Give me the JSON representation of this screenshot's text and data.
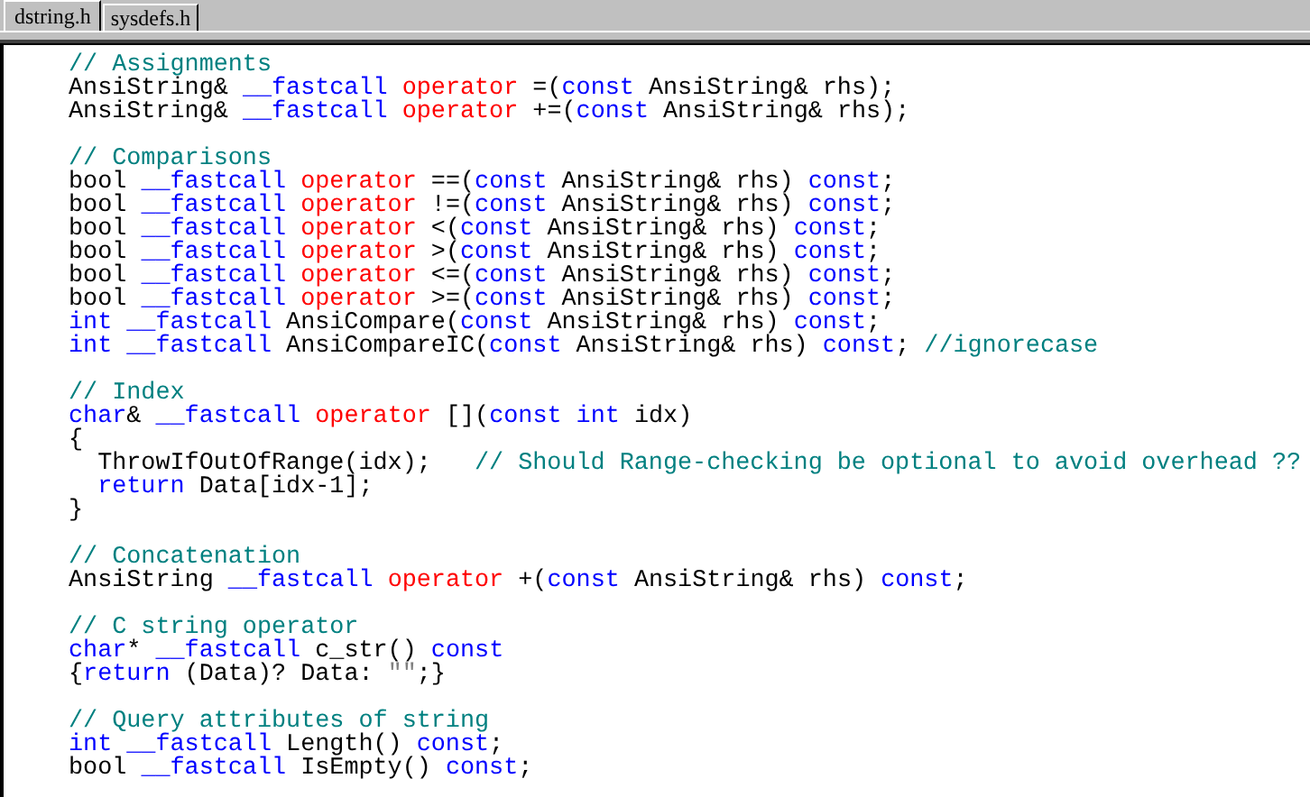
{
  "tabs": [
    {
      "label": "dstring.h",
      "selected": true
    },
    {
      "label": "sysdefs.h",
      "selected": false
    }
  ],
  "blocks": [
    {
      "lines": [
        {
          "tokens": [
            {
              "kind": "comment",
              "text": "// Assignments"
            }
          ]
        },
        {
          "tokens": [
            {
              "kind": "plain",
              "text": "AnsiString& "
            },
            {
              "kind": "keyword",
              "text": "__fastcall "
            },
            {
              "kind": "operator",
              "text": "operator"
            },
            {
              "kind": "plain",
              "text": " =("
            },
            {
              "kind": "keyword",
              "text": "const"
            },
            {
              "kind": "plain",
              "text": " AnsiString& rhs);"
            }
          ]
        },
        {
          "tokens": [
            {
              "kind": "plain",
              "text": "AnsiString& "
            },
            {
              "kind": "keyword",
              "text": "__fastcall "
            },
            {
              "kind": "operator",
              "text": "operator"
            },
            {
              "kind": "plain",
              "text": " +=("
            },
            {
              "kind": "keyword",
              "text": "const"
            },
            {
              "kind": "plain",
              "text": " AnsiString& rhs);"
            }
          ]
        }
      ]
    },
    {
      "lines": [
        {
          "tokens": [
            {
              "kind": "comment",
              "text": "// Comparisons"
            }
          ]
        },
        {
          "tokens": [
            {
              "kind": "plain",
              "text": "bool "
            },
            {
              "kind": "keyword",
              "text": "__fastcall "
            },
            {
              "kind": "operator",
              "text": "operator"
            },
            {
              "kind": "plain",
              "text": " ==("
            },
            {
              "kind": "keyword",
              "text": "const"
            },
            {
              "kind": "plain",
              "text": " AnsiString& rhs) "
            },
            {
              "kind": "keyword",
              "text": "const"
            },
            {
              "kind": "plain",
              "text": ";"
            }
          ]
        },
        {
          "tokens": [
            {
              "kind": "plain",
              "text": "bool "
            },
            {
              "kind": "keyword",
              "text": "__fastcall "
            },
            {
              "kind": "operator",
              "text": "operator"
            },
            {
              "kind": "plain",
              "text": " !=("
            },
            {
              "kind": "keyword",
              "text": "const"
            },
            {
              "kind": "plain",
              "text": " AnsiString& rhs) "
            },
            {
              "kind": "keyword",
              "text": "const"
            },
            {
              "kind": "plain",
              "text": ";"
            }
          ]
        },
        {
          "tokens": [
            {
              "kind": "plain",
              "text": "bool "
            },
            {
              "kind": "keyword",
              "text": "__fastcall "
            },
            {
              "kind": "operator",
              "text": "operator"
            },
            {
              "kind": "plain",
              "text": " <("
            },
            {
              "kind": "keyword",
              "text": "const"
            },
            {
              "kind": "plain",
              "text": " AnsiString& rhs) "
            },
            {
              "kind": "keyword",
              "text": "const"
            },
            {
              "kind": "plain",
              "text": ";"
            }
          ]
        },
        {
          "tokens": [
            {
              "kind": "plain",
              "text": "bool "
            },
            {
              "kind": "keyword",
              "text": "__fastcall "
            },
            {
              "kind": "operator",
              "text": "operator"
            },
            {
              "kind": "plain",
              "text": " >("
            },
            {
              "kind": "keyword",
              "text": "const"
            },
            {
              "kind": "plain",
              "text": " AnsiString& rhs) "
            },
            {
              "kind": "keyword",
              "text": "const"
            },
            {
              "kind": "plain",
              "text": ";"
            }
          ]
        },
        {
          "tokens": [
            {
              "kind": "plain",
              "text": "bool "
            },
            {
              "kind": "keyword",
              "text": "__fastcall "
            },
            {
              "kind": "operator",
              "text": "operator"
            },
            {
              "kind": "plain",
              "text": " <=("
            },
            {
              "kind": "keyword",
              "text": "const"
            },
            {
              "kind": "plain",
              "text": " AnsiString& rhs) "
            },
            {
              "kind": "keyword",
              "text": "const"
            },
            {
              "kind": "plain",
              "text": ";"
            }
          ]
        },
        {
          "tokens": [
            {
              "kind": "plain",
              "text": "bool "
            },
            {
              "kind": "keyword",
              "text": "__fastcall "
            },
            {
              "kind": "operator",
              "text": "operator"
            },
            {
              "kind": "plain",
              "text": " >=("
            },
            {
              "kind": "keyword",
              "text": "const"
            },
            {
              "kind": "plain",
              "text": " AnsiString& rhs) "
            },
            {
              "kind": "keyword",
              "text": "const"
            },
            {
              "kind": "plain",
              "text": ";"
            }
          ]
        },
        {
          "tokens": [
            {
              "kind": "keyword",
              "text": "int __fastcall"
            },
            {
              "kind": "plain",
              "text": " AnsiCompare("
            },
            {
              "kind": "keyword",
              "text": "const"
            },
            {
              "kind": "plain",
              "text": " AnsiString& rhs) "
            },
            {
              "kind": "keyword",
              "text": "const"
            },
            {
              "kind": "plain",
              "text": ";"
            }
          ]
        },
        {
          "tokens": [
            {
              "kind": "keyword",
              "text": "int __fastcall"
            },
            {
              "kind": "plain",
              "text": " AnsiCompareIC("
            },
            {
              "kind": "keyword",
              "text": "const"
            },
            {
              "kind": "plain",
              "text": " AnsiString& rhs) "
            },
            {
              "kind": "keyword",
              "text": "const"
            },
            {
              "kind": "plain",
              "text": "; "
            },
            {
              "kind": "comment",
              "text": "//ignorecase"
            }
          ]
        }
      ]
    },
    {
      "lines": [
        {
          "tokens": [
            {
              "kind": "comment",
              "text": "// Index"
            }
          ]
        },
        {
          "tokens": [
            {
              "kind": "keyword",
              "text": "char"
            },
            {
              "kind": "plain",
              "text": "& "
            },
            {
              "kind": "keyword",
              "text": "__fastcall "
            },
            {
              "kind": "operator",
              "text": "operator"
            },
            {
              "kind": "plain",
              "text": " []("
            },
            {
              "kind": "keyword",
              "text": "const int"
            },
            {
              "kind": "plain",
              "text": " idx)"
            }
          ]
        },
        {
          "tokens": [
            {
              "kind": "plain",
              "text": "{"
            }
          ]
        },
        {
          "tokens": [
            {
              "kind": "plain",
              "text": "  ThrowIfOutOfRange(idx);   "
            },
            {
              "kind": "comment",
              "text": "// Should Range-checking be optional to avoid overhead ??"
            }
          ]
        },
        {
          "tokens": [
            {
              "kind": "keyword",
              "text": "  return"
            },
            {
              "kind": "plain",
              "text": " Data[idx-1];"
            }
          ]
        },
        {
          "tokens": [
            {
              "kind": "plain",
              "text": "}"
            }
          ]
        }
      ]
    },
    {
      "lines": [
        {
          "tokens": [
            {
              "kind": "comment",
              "text": "// Concatenation"
            }
          ]
        },
        {
          "tokens": [
            {
              "kind": "plain",
              "text": "AnsiString "
            },
            {
              "kind": "keyword",
              "text": "__fastcall "
            },
            {
              "kind": "operator",
              "text": "operator"
            },
            {
              "kind": "plain",
              "text": " +("
            },
            {
              "kind": "keyword",
              "text": "const"
            },
            {
              "kind": "plain",
              "text": " AnsiString& rhs) "
            },
            {
              "kind": "keyword",
              "text": "const"
            },
            {
              "kind": "plain",
              "text": ";"
            }
          ]
        }
      ]
    },
    {
      "lines": [
        {
          "tokens": [
            {
              "kind": "comment",
              "text": "// C string operator"
            }
          ]
        },
        {
          "tokens": [
            {
              "kind": "keyword",
              "text": "char"
            },
            {
              "kind": "plain",
              "text": "* "
            },
            {
              "kind": "keyword",
              "text": "__fastcall"
            },
            {
              "kind": "plain",
              "text": " c_str() "
            },
            {
              "kind": "keyword",
              "text": "const"
            }
          ]
        },
        {
          "tokens": [
            {
              "kind": "plain",
              "text": "{"
            },
            {
              "kind": "keyword",
              "text": "return"
            },
            {
              "kind": "plain",
              "text": " (Data)? Data: "
            },
            {
              "kind": "string",
              "text": "\"\""
            },
            {
              "kind": "plain",
              "text": ";}"
            }
          ]
        }
      ]
    },
    {
      "lines": [
        {
          "tokens": [
            {
              "kind": "comment",
              "text": "// Query attributes of string"
            }
          ]
        },
        {
          "tokens": [
            {
              "kind": "keyword",
              "text": "int __fastcall"
            },
            {
              "kind": "plain",
              "text": " Length() "
            },
            {
              "kind": "keyword",
              "text": "const"
            },
            {
              "kind": "plain",
              "text": ";"
            }
          ]
        },
        {
          "tokens": [
            {
              "kind": "plain",
              "text": "bool "
            },
            {
              "kind": "keyword",
              "text": "__fastcall"
            },
            {
              "kind": "plain",
              "text": " IsEmpty() "
            },
            {
              "kind": "keyword",
              "text": "const"
            },
            {
              "kind": "plain",
              "text": ";"
            }
          ]
        }
      ]
    }
  ]
}
